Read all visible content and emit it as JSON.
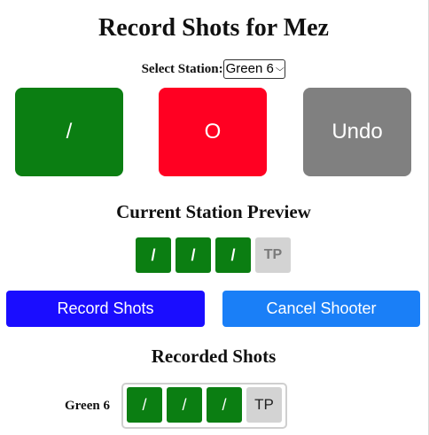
{
  "header": {
    "title": "Record Shots for Mez"
  },
  "station": {
    "label": "Select Station:",
    "selected": "Green 6"
  },
  "action_buttons": {
    "hit_label": "/",
    "miss_label": "O",
    "undo_label": "Undo"
  },
  "preview": {
    "title": "Current Station Preview",
    "shots": [
      "/",
      "/",
      "/",
      "TP"
    ]
  },
  "controls": {
    "record_label": "Record Shots",
    "cancel_label": "Cancel Shooter"
  },
  "recorded": {
    "title": "Recorded Shots",
    "rows": [
      {
        "station": "Green 6",
        "shots": [
          "/",
          "/",
          "/",
          "TP"
        ]
      }
    ]
  },
  "colors": {
    "hit": "#0b7e12",
    "miss": "#ff0022",
    "undo": "#808080",
    "record": "#1a0dff",
    "cancel": "#1a7ff7",
    "tp": "#d3d3d3"
  }
}
